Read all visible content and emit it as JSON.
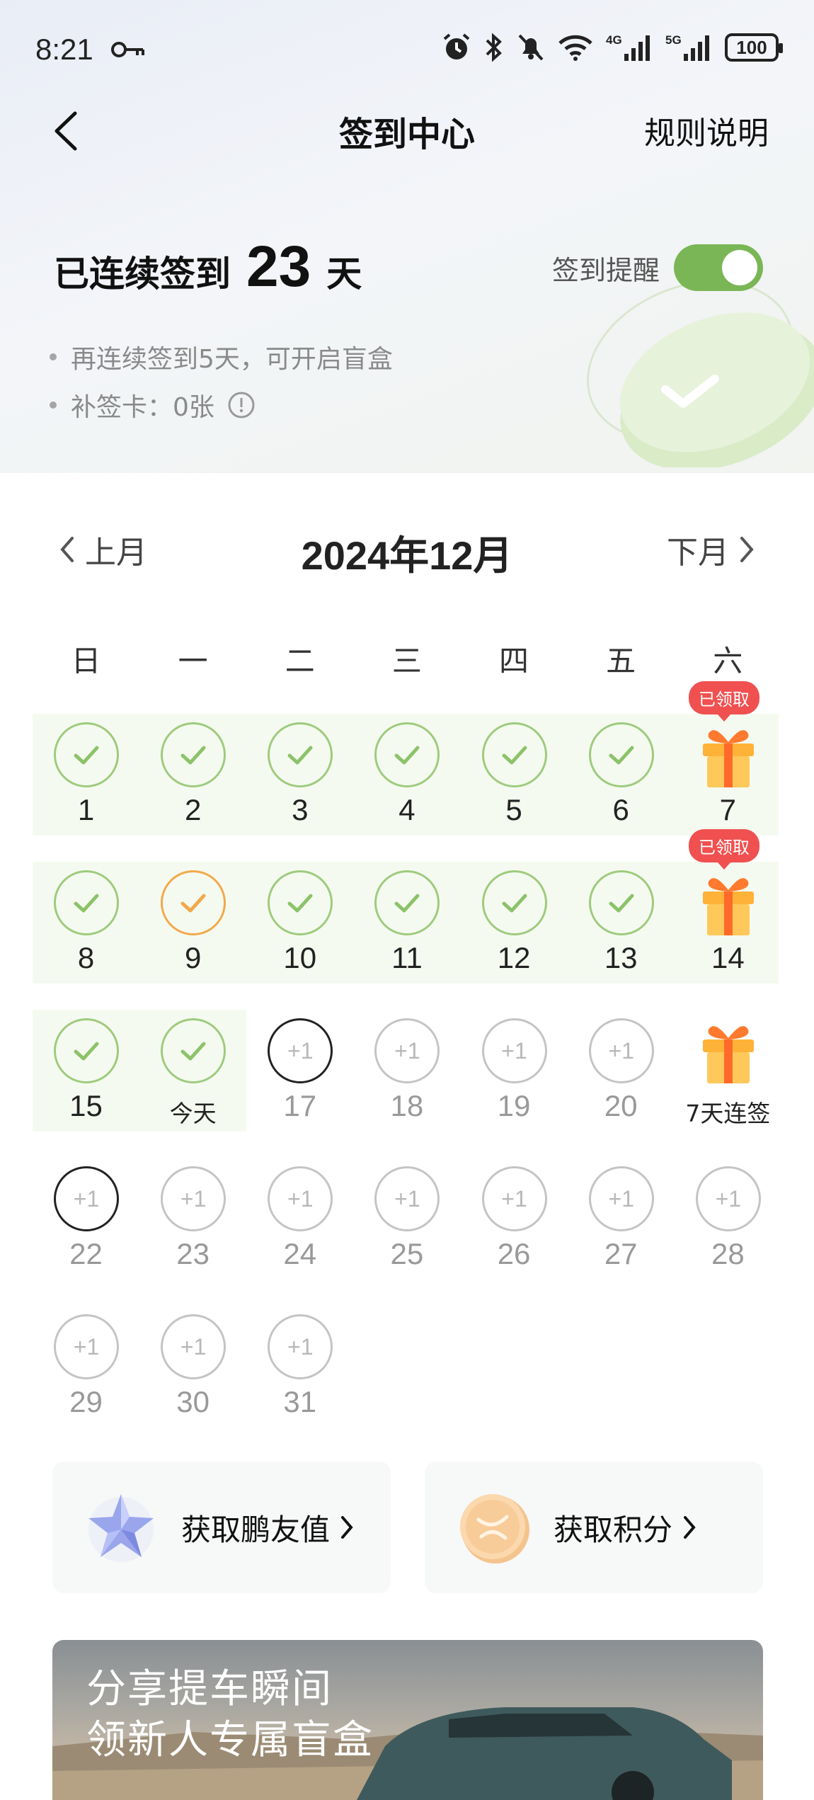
{
  "status_bar": {
    "time": "8:21",
    "battery": "100"
  },
  "nav": {
    "title": "签到中心",
    "rules_label": "规则说明"
  },
  "streak": {
    "prefix": "已连续签到",
    "days": "23",
    "suffix": "天"
  },
  "reminder": {
    "label": "签到提醒",
    "on": true
  },
  "tips": {
    "line1": "再连续签到5天，可开启盲盒",
    "line2": "补签卡：0张"
  },
  "calendar": {
    "prev_label": "上月",
    "next_label": "下月",
    "month_title": "2024年12月",
    "weekdays": [
      "日",
      "一",
      "二",
      "三",
      "四",
      "五",
      "六"
    ],
    "plus_label": "+1",
    "claimed_label": "已领取",
    "weeks": [
      [
        {
          "label": "1",
          "state": "signed"
        },
        {
          "label": "2",
          "state": "signed"
        },
        {
          "label": "3",
          "state": "signed"
        },
        {
          "label": "4",
          "state": "signed"
        },
        {
          "label": "5",
          "state": "signed"
        },
        {
          "label": "6",
          "state": "signed"
        },
        {
          "label": "7",
          "state": "gift-claimed"
        }
      ],
      [
        {
          "label": "8",
          "state": "signed"
        },
        {
          "label": "9",
          "state": "signed-makeup"
        },
        {
          "label": "10",
          "state": "signed"
        },
        {
          "label": "11",
          "state": "signed"
        },
        {
          "label": "12",
          "state": "signed"
        },
        {
          "label": "13",
          "state": "signed"
        },
        {
          "label": "14",
          "state": "gift-claimed"
        }
      ],
      [
        {
          "label": "15",
          "state": "signed"
        },
        {
          "label": "今天",
          "state": "signed-today"
        },
        {
          "label": "17",
          "state": "future-next"
        },
        {
          "label": "18",
          "state": "future"
        },
        {
          "label": "19",
          "state": "future"
        },
        {
          "label": "20",
          "state": "future"
        },
        {
          "label": "7天连签",
          "state": "gift-pending"
        }
      ],
      [
        {
          "label": "22",
          "state": "future-next"
        },
        {
          "label": "23",
          "state": "future"
        },
        {
          "label": "24",
          "state": "future"
        },
        {
          "label": "25",
          "state": "future"
        },
        {
          "label": "26",
          "state": "future"
        },
        {
          "label": "27",
          "state": "future"
        },
        {
          "label": "28",
          "state": "future"
        }
      ],
      [
        {
          "label": "29",
          "state": "future"
        },
        {
          "label": "30",
          "state": "future"
        },
        {
          "label": "31",
          "state": "future"
        }
      ]
    ]
  },
  "cards": {
    "left_label": "获取鹏友值",
    "right_label": "获取积分"
  },
  "banner": {
    "line1": "分享提车瞬间",
    "line2": "领新人专属盲盒"
  },
  "colors": {
    "accent_green": "#7ab656",
    "check_green": "#9ecb7e",
    "makeup_orange": "#f2a94b",
    "badge_red": "#f05050"
  }
}
